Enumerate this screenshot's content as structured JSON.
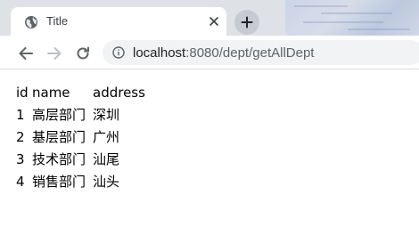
{
  "browser": {
    "tab_title": "Title",
    "url_host": "localhost",
    "url_path": ":8080/dept/getAllDept",
    "icons": {
      "favicon": "globe-icon",
      "tab_close": "close-icon",
      "new_tab": "plus-icon",
      "back": "arrow-left-icon",
      "forward": "arrow-right-icon",
      "reload": "reload-icon",
      "site_info": "info-icon"
    }
  },
  "table": {
    "headers": [
      "id",
      "name",
      "address"
    ],
    "rows": [
      [
        "1",
        "高层部门",
        "深圳"
      ],
      [
        "2",
        "基层部门",
        "广州"
      ],
      [
        "3",
        "技术部门",
        "汕尾"
      ],
      [
        "4",
        "销售部门",
        "汕头"
      ]
    ]
  }
}
